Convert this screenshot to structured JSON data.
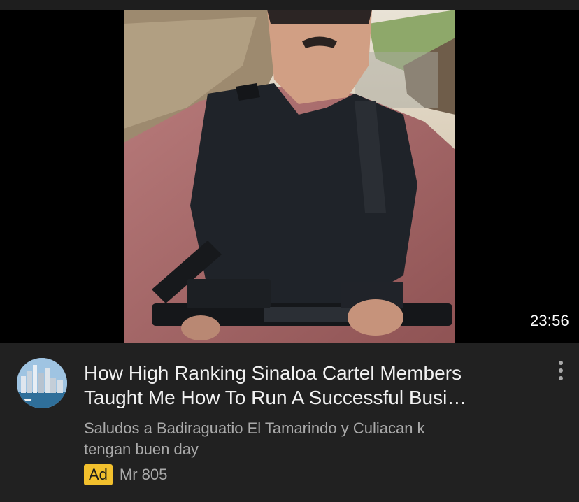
{
  "video": {
    "thumbnail_alt": "thumbnail-photo",
    "duration": "23:56",
    "title_line1": "How High Ranking Sinaloa Cartel Members",
    "title_line2": "Taught Me How To Run A Successful Busi…",
    "description_line1": "Saludos a Badiraguatio El Tamarindo y Culiacan k",
    "description_line2": "tengan buen day",
    "ad_label": "Ad",
    "advertiser": "Mr 805"
  },
  "icons": {
    "menu": "more-vert-icon",
    "avatar": "channel-avatar"
  },
  "colors": {
    "background": "#212121",
    "ad_badge": "#f2c02d",
    "title": "#f1f1f1",
    "secondary_text": "#aaaaaa"
  }
}
